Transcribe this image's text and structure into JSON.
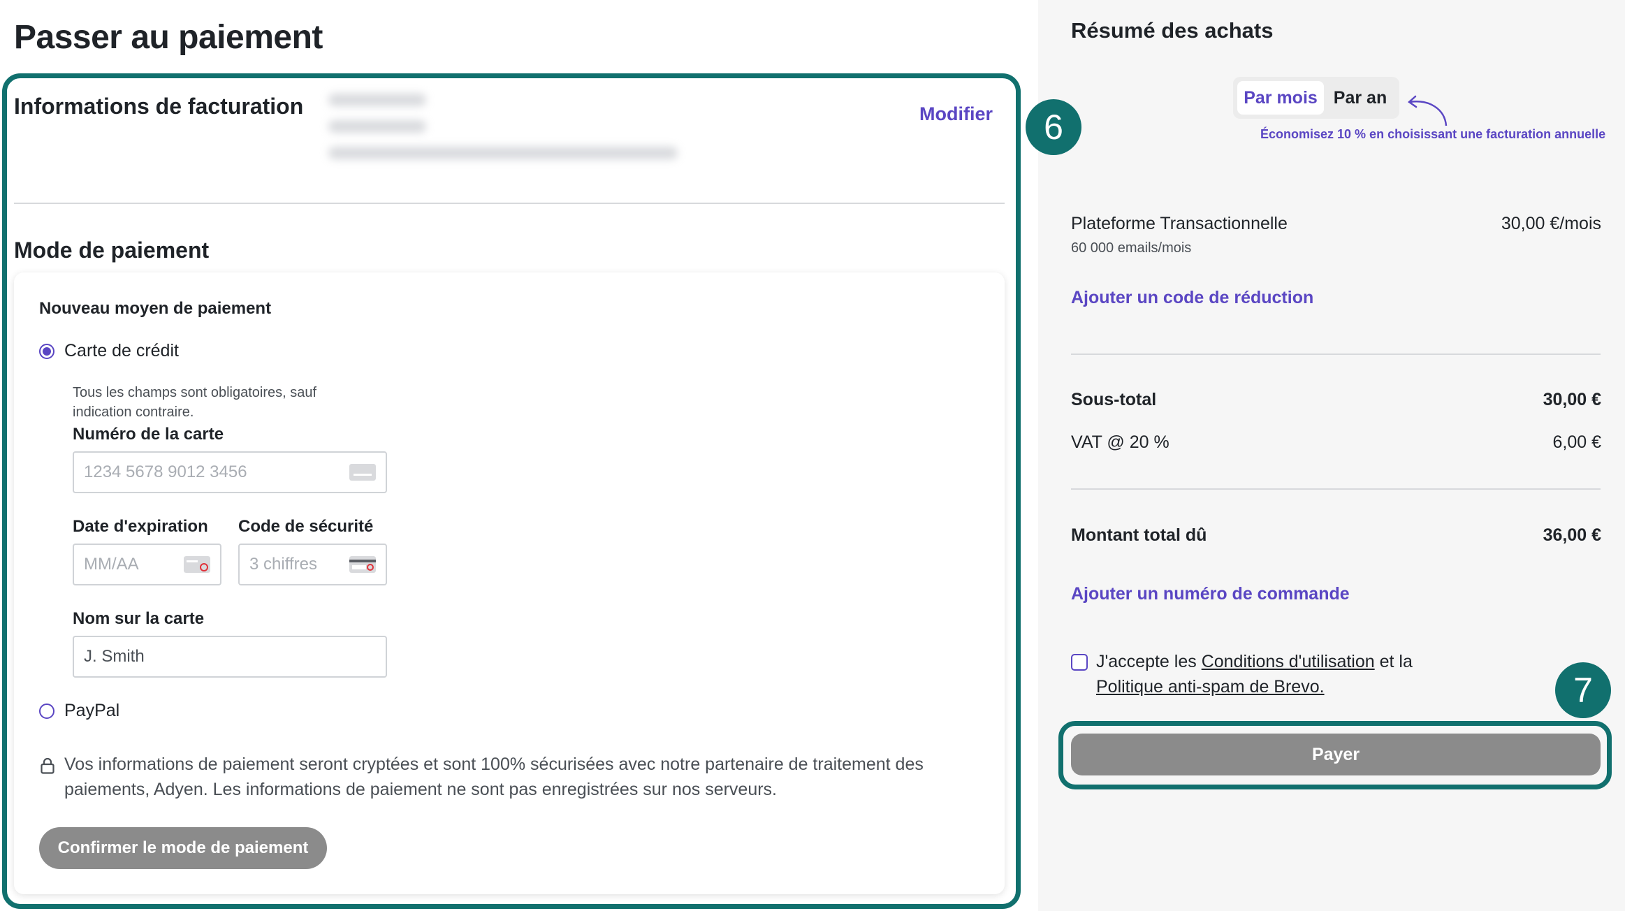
{
  "page_title": "Passer au paiement",
  "billing": {
    "title": "Informations de facturation",
    "modify_label": "Modifier"
  },
  "payment_mode": {
    "title": "Mode de paiement",
    "new_method_title": "Nouveau moyen de paiement",
    "credit_card_label": "Carte de crédit",
    "credit_card_selected": true,
    "helper_text": "Tous les champs sont obligatoires, sauf indication contraire.",
    "card_number": {
      "label": "Numéro de la carte",
      "placeholder": "1234 5678 9012 3456"
    },
    "expiry": {
      "label": "Date d'expiration",
      "placeholder": "MM/AA"
    },
    "security_code": {
      "label": "Code de sécurité",
      "placeholder": "3 chiffres"
    },
    "name_on_card": {
      "label": "Nom sur la carte",
      "value": "J. Smith"
    },
    "paypal_label": "PayPal",
    "secure_text": "Vos informations de paiement seront cryptées et sont 100% sécurisées avec notre partenaire de traitement des paiements, Adyen. Les informations de paiement ne sont pas enregistrées sur nos serveurs.",
    "confirm_button": "Confirmer le mode de paiement"
  },
  "badges": {
    "left": "6",
    "right": "7"
  },
  "summary": {
    "title": "Résumé des achats",
    "toggle": {
      "monthly": "Par mois",
      "yearly": "Par an",
      "active": "monthly"
    },
    "savings_note": "Économisez 10 % en choisissant une facturation annuelle",
    "item": {
      "name": "Plateforme Transactionnelle",
      "price": "30,00 €/mois",
      "detail": "60 000 emails/mois"
    },
    "discount_link": "Ajouter un code de réduction",
    "subtotal_label": "Sous-total",
    "subtotal_value": "30,00 €",
    "vat_label": "VAT @ 20 %",
    "vat_value": "6,00 €",
    "total_label": "Montant total dû",
    "total_value": "36,00 €",
    "order_link": "Ajouter un numéro de commande",
    "terms_prefix": "J'accepte les ",
    "terms_link": "Conditions d'utilisation",
    "terms_middle": " et la ",
    "policy_link": "Politique anti-spam de Brevo.",
    "pay_button": "Payer"
  },
  "colors": {
    "accent": "#5a46c3",
    "highlight": "#11706e",
    "disabled_button": "#8b8b8b"
  },
  "icons": [
    "credit-card-icon",
    "expiry-card-icon",
    "security-code-card-icon",
    "lock-icon",
    "curved-arrow-icon"
  ]
}
